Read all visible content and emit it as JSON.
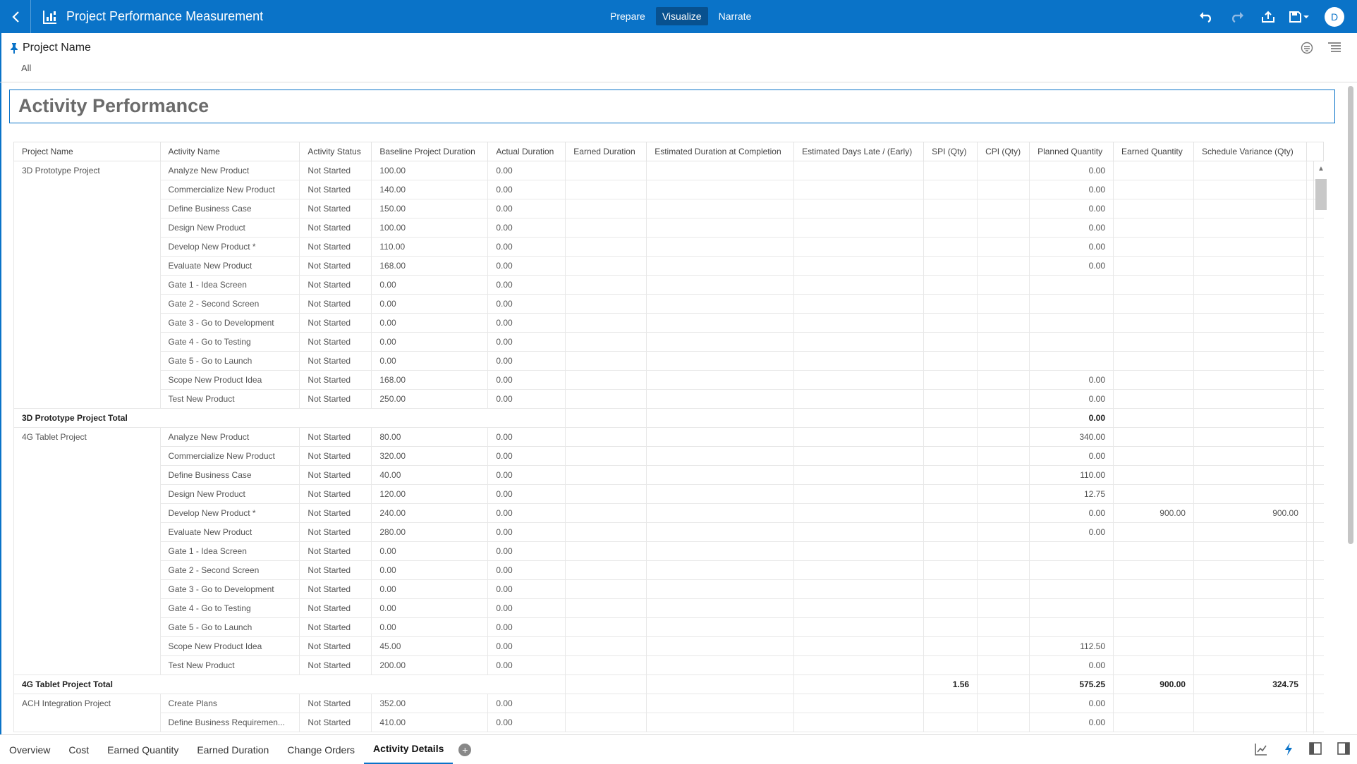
{
  "header": {
    "title": "Project Performance Measurement",
    "modes": [
      "Prepare",
      "Visualize",
      "Narrate"
    ],
    "active_mode": "Visualize",
    "avatar_initial": "D",
    "accent": "#0a73c8"
  },
  "filter": {
    "label": "Project Name",
    "value": "All"
  },
  "viz": {
    "title": "Activity Performance"
  },
  "table": {
    "columns": [
      "Project Name",
      "Activity Name",
      "Activity Status",
      "Baseline Project Duration",
      "Actual Duration",
      "Earned Duration",
      "Estimated Duration at Completion",
      "Estimated Days Late / (Early)",
      "SPI (Qty)",
      "CPI (Qty)",
      "Planned Quantity",
      "Earned Quantity",
      "Schedule Variance (Qty)"
    ],
    "groups": [
      {
        "project": "3D Prototype Project",
        "rows": [
          [
            "Analyze New Product",
            "Not Started",
            "100.00",
            "0.00",
            "0.00",
            "",
            ""
          ],
          [
            "Commercialize New Product",
            "Not Started",
            "140.00",
            "0.00",
            "0.00",
            "",
            ""
          ],
          [
            "Define Business Case",
            "Not Started",
            "150.00",
            "0.00",
            "0.00",
            "",
            ""
          ],
          [
            "Design New Product",
            "Not Started",
            "100.00",
            "0.00",
            "0.00",
            "",
            ""
          ],
          [
            "Develop New Product *",
            "Not Started",
            "110.00",
            "0.00",
            "0.00",
            "",
            ""
          ],
          [
            "Evaluate New Product",
            "Not Started",
            "168.00",
            "0.00",
            "0.00",
            "",
            ""
          ],
          [
            "Gate 1 - Idea Screen",
            "Not Started",
            "0.00",
            "0.00",
            "",
            "",
            ""
          ],
          [
            "Gate 2 - Second Screen",
            "Not Started",
            "0.00",
            "0.00",
            "",
            "",
            ""
          ],
          [
            "Gate 3 - Go to Development",
            "Not Started",
            "0.00",
            "0.00",
            "",
            "",
            ""
          ],
          [
            "Gate 4 - Go to Testing",
            "Not Started",
            "0.00",
            "0.00",
            "",
            "",
            ""
          ],
          [
            "Gate 5 - Go to Launch",
            "Not Started",
            "0.00",
            "0.00",
            "",
            "",
            ""
          ],
          [
            "Scope New Product Idea",
            "Not Started",
            "168.00",
            "0.00",
            "0.00",
            "",
            ""
          ],
          [
            "Test New Product",
            "Not Started",
            "250.00",
            "0.00",
            "0.00",
            "",
            ""
          ]
        ],
        "total": {
          "label": "3D Prototype Project Total",
          "spi": "",
          "planned": "0.00",
          "earned": "",
          "sv": ""
        }
      },
      {
        "project": "4G Tablet Project",
        "rows": [
          [
            "Analyze New Product",
            "Not Started",
            "80.00",
            "0.00",
            "340.00",
            "",
            ""
          ],
          [
            "Commercialize New Product",
            "Not Started",
            "320.00",
            "0.00",
            "0.00",
            "",
            ""
          ],
          [
            "Define Business Case",
            "Not Started",
            "40.00",
            "0.00",
            "110.00",
            "",
            ""
          ],
          [
            "Design New Product",
            "Not Started",
            "120.00",
            "0.00",
            "12.75",
            "",
            ""
          ],
          [
            "Develop New Product *",
            "Not Started",
            "240.00",
            "0.00",
            "0.00",
            "900.00",
            "900.00"
          ],
          [
            "Evaluate New Product",
            "Not Started",
            "280.00",
            "0.00",
            "0.00",
            "",
            ""
          ],
          [
            "Gate 1 - Idea Screen",
            "Not Started",
            "0.00",
            "0.00",
            "",
            "",
            ""
          ],
          [
            "Gate 2 - Second Screen",
            "Not Started",
            "0.00",
            "0.00",
            "",
            "",
            ""
          ],
          [
            "Gate 3 - Go to Development",
            "Not Started",
            "0.00",
            "0.00",
            "",
            "",
            ""
          ],
          [
            "Gate 4 - Go to Testing",
            "Not Started",
            "0.00",
            "0.00",
            "",
            "",
            ""
          ],
          [
            "Gate 5 - Go to Launch",
            "Not Started",
            "0.00",
            "0.00",
            "",
            "",
            ""
          ],
          [
            "Scope New Product Idea",
            "Not Started",
            "45.00",
            "0.00",
            "112.50",
            "",
            ""
          ],
          [
            "Test New Product",
            "Not Started",
            "200.00",
            "0.00",
            "0.00",
            "",
            ""
          ]
        ],
        "total": {
          "label": "4G Tablet Project Total",
          "spi": "1.56",
          "planned": "575.25",
          "earned": "900.00",
          "sv": "324.75"
        }
      },
      {
        "project": "ACH Integration Project",
        "rows": [
          [
            "Create Plans",
            "Not Started",
            "352.00",
            "0.00",
            "0.00",
            "",
            ""
          ],
          [
            "Define Business Requiremen...",
            "Not Started",
            "410.00",
            "0.00",
            "0.00",
            "",
            ""
          ]
        ]
      }
    ]
  },
  "tabs": [
    "Overview",
    "Cost",
    "Earned Quantity",
    "Earned Duration",
    "Change Orders",
    "Activity Details"
  ],
  "active_tab": "Activity Details",
  "icons": {
    "back": "chevron-left-icon",
    "app": "chart-icon",
    "undo": "undo-icon",
    "redo": "redo-icon",
    "export": "export-icon",
    "save": "save-icon",
    "pin": "pin-icon",
    "add_tab": "plus-circle-icon"
  }
}
